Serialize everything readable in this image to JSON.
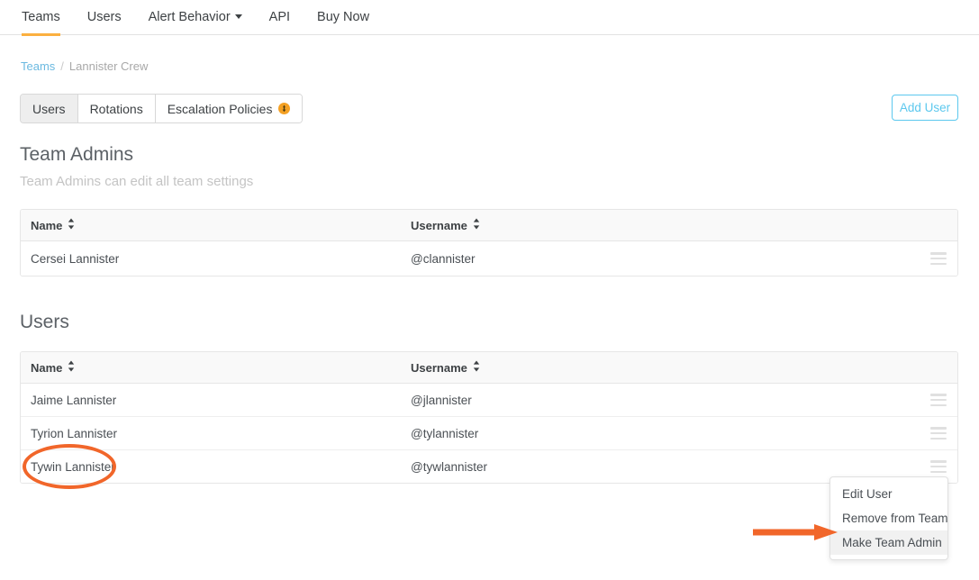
{
  "topnav": {
    "items": [
      {
        "label": "Teams",
        "active": true,
        "has_caret": false
      },
      {
        "label": "Users",
        "active": false,
        "has_caret": false
      },
      {
        "label": "Alert Behavior",
        "active": false,
        "has_caret": true
      },
      {
        "label": "API",
        "active": false,
        "has_caret": false
      },
      {
        "label": "Buy Now",
        "active": false,
        "has_caret": false
      }
    ],
    "active_underline_color": "#fbb040"
  },
  "breadcrumb": {
    "root": "Teams",
    "separator": "/",
    "current": "Lannister Crew",
    "link_color": "#6bb9e0"
  },
  "tabs": {
    "items": [
      {
        "label": "Users",
        "active": true,
        "badge": false
      },
      {
        "label": "Rotations",
        "active": false,
        "badge": false
      },
      {
        "label": "Escalation Policies",
        "active": false,
        "badge": true
      }
    ],
    "badge_color": "#f4a124",
    "badge_icon": "down-arrow-icon"
  },
  "toolbar": {
    "add_user_label": "Add User",
    "add_user_color": "#5cc8ee"
  },
  "team_admins": {
    "title": "Team Admins",
    "subtitle": "Team Admins can edit all team settings",
    "columns": [
      "Name",
      "Username"
    ],
    "rows": [
      {
        "name": "Cersei Lannister",
        "username": "@clannister"
      }
    ]
  },
  "users": {
    "title": "Users",
    "columns": [
      "Name",
      "Username"
    ],
    "rows": [
      {
        "name": "Jaime Lannister",
        "username": "@jlannister"
      },
      {
        "name": "Tyrion Lannister",
        "username": "@tylannister"
      },
      {
        "name": "Tywin Lannister",
        "username": "@tywlannister"
      }
    ]
  },
  "row_menu": {
    "icon": "hamburger-menu-icon"
  },
  "dropdown": {
    "items": [
      {
        "label": "Edit User",
        "highlighted": false
      },
      {
        "label": "Remove from Team",
        "highlighted": false
      },
      {
        "label": "Make Team Admin",
        "highlighted": true
      }
    ]
  },
  "annotations": {
    "ellipse_target": "Tywin Lannister",
    "arrow_target": "Make Team Admin",
    "color": "#f1662a"
  }
}
